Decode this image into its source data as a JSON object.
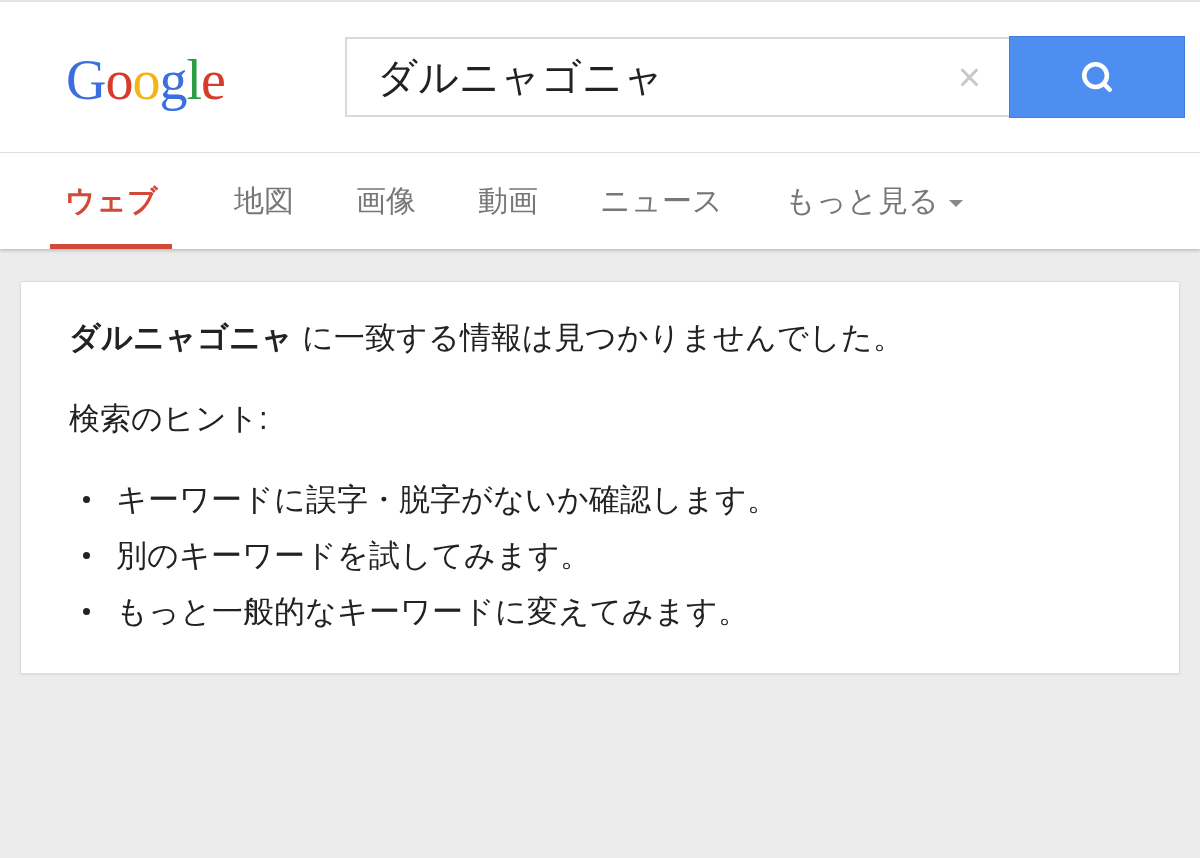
{
  "header": {
    "logo": "Google",
    "search": {
      "value": "ダルニャゴニャ",
      "clear": "×"
    }
  },
  "tabs": [
    {
      "label": "ウェブ",
      "selected": true
    },
    {
      "label": "地図",
      "selected": false
    },
    {
      "label": "画像",
      "selected": false
    },
    {
      "label": "動画",
      "selected": false
    },
    {
      "label": "ニュース",
      "selected": false
    },
    {
      "label": "もっと見る",
      "selected": false,
      "kind": "dropdown"
    }
  ],
  "result": {
    "message": "**ダルニャゴニャ** に一致する情報は見つかりませんでした。",
    "hints_title": "検索のヒント:",
    "hints": [
      "キーワードに誤字・脱字がないか確認します。",
      "別のキーワードを試してみます。",
      "もっと一般的なキーワードに変えてみます。"
    ]
  }
}
